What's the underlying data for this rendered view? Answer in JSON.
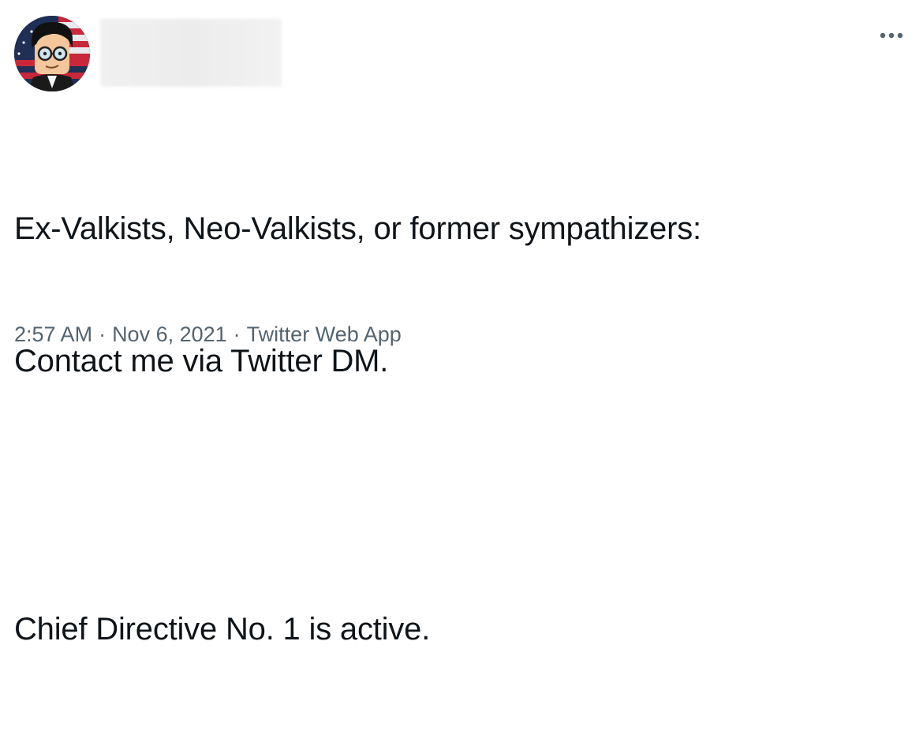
{
  "tweet": {
    "line1": "Ex-Valkists, Neo-Valkists, or former sympathizers:",
    "line2": "Contact me via Twitter DM.",
    "line3": "Chief Directive No. 1 is active.",
    "time": "2:57 AM",
    "date": "Nov 6, 2021",
    "source": "Twitter Web App",
    "separator": "·"
  },
  "icons": {
    "avatar": "avatar-icon",
    "more": "more-horizontal-icon"
  },
  "colors": {
    "text": "#0f1419",
    "meta": "#536471"
  }
}
